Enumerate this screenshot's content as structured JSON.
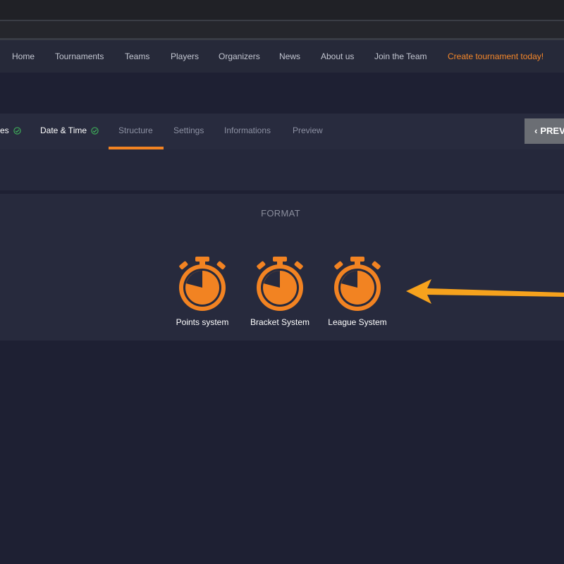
{
  "nav": {
    "items": [
      "Home",
      "Tournaments",
      "Teams",
      "Players",
      "Organizers",
      "News",
      "About us",
      "Join the Team"
    ],
    "cta": "Create tournament today!"
  },
  "steps": {
    "tabs": [
      {
        "label": "es",
        "status": "done"
      },
      {
        "label": "Date & Time",
        "status": "done"
      },
      {
        "label": "Structure",
        "status": "active"
      },
      {
        "label": "Settings",
        "status": "pending"
      },
      {
        "label": "Informations",
        "status": "pending"
      },
      {
        "label": "Preview",
        "status": "pending"
      }
    ],
    "prev_button": "PREV"
  },
  "format": {
    "title": "FORMAT",
    "options": [
      {
        "label": "Points system",
        "icon": "stopwatch-icon"
      },
      {
        "label": "Bracket System",
        "icon": "stopwatch-icon"
      },
      {
        "label": "League System",
        "icon": "stopwatch-icon"
      }
    ]
  },
  "colors": {
    "accent": "#f28322",
    "check": "#3fae5a",
    "background": "#1e2033"
  }
}
